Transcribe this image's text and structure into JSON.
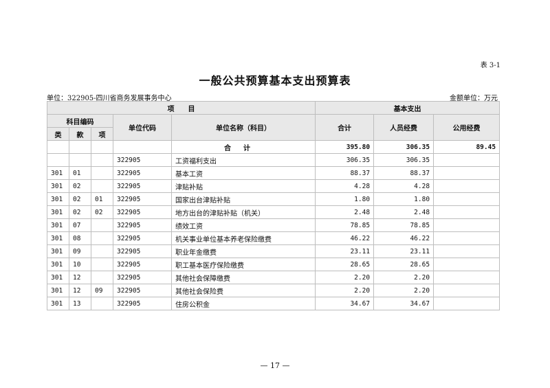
{
  "table_no": "表 3-1",
  "title": "一般公共预算基本支出预算表",
  "unit_left": "单位：322905-四川省商务发展事务中心",
  "unit_right": "金额单位：万元",
  "headers": {
    "item": "项　　目",
    "basic_expense": "基本支出",
    "subject_code": "科目编码",
    "lei": "类",
    "kuan": "款",
    "xiang": "项",
    "unit_code": "单位代码",
    "unit_name": "单位名称（科目）",
    "total": "合计",
    "personnel": "人员经费",
    "public": "公用经费"
  },
  "total_row": {
    "label": "合计",
    "total": "395.80",
    "personnel": "306.35",
    "public": "89.45"
  },
  "rows": [
    {
      "lei": "",
      "kuan": "",
      "xiang": "",
      "unit_code": "322905",
      "name": "工资福利支出",
      "total": "306.35",
      "personnel": "306.35",
      "public": "",
      "indent": false
    },
    {
      "lei": "301",
      "kuan": "01",
      "xiang": "",
      "unit_code": "322905",
      "name": "基本工资",
      "total": "88.37",
      "personnel": "88.37",
      "public": "",
      "indent": false
    },
    {
      "lei": "301",
      "kuan": "02",
      "xiang": "",
      "unit_code": "322905",
      "name": "津贴补贴",
      "total": "4.28",
      "personnel": "4.28",
      "public": "",
      "indent": false
    },
    {
      "lei": "301",
      "kuan": "02",
      "xiang": "01",
      "unit_code": "322905",
      "name": "国家出台津贴补贴",
      "total": "1.80",
      "personnel": "1.80",
      "public": "",
      "indent": true
    },
    {
      "lei": "301",
      "kuan": "02",
      "xiang": "02",
      "unit_code": "322905",
      "name": "地方出台的津贴补贴（机关）",
      "total": "2.48",
      "personnel": "2.48",
      "public": "",
      "indent": true
    },
    {
      "lei": "301",
      "kuan": "07",
      "xiang": "",
      "unit_code": "322905",
      "name": "绩效工资",
      "total": "78.85",
      "personnel": "78.85",
      "public": "",
      "indent": false
    },
    {
      "lei": "301",
      "kuan": "08",
      "xiang": "",
      "unit_code": "322905",
      "name": "机关事业单位基本养老保险缴费",
      "total": "46.22",
      "personnel": "46.22",
      "public": "",
      "indent": false
    },
    {
      "lei": "301",
      "kuan": "09",
      "xiang": "",
      "unit_code": "322905",
      "name": "职业年金缴费",
      "total": "23.11",
      "personnel": "23.11",
      "public": "",
      "indent": false
    },
    {
      "lei": "301",
      "kuan": "10",
      "xiang": "",
      "unit_code": "322905",
      "name": "职工基本医疗保险缴费",
      "total": "28.65",
      "personnel": "28.65",
      "public": "",
      "indent": false
    },
    {
      "lei": "301",
      "kuan": "12",
      "xiang": "",
      "unit_code": "322905",
      "name": "其他社会保障缴费",
      "total": "2.20",
      "personnel": "2.20",
      "public": "",
      "indent": false
    },
    {
      "lei": "301",
      "kuan": "12",
      "xiang": "09",
      "unit_code": "322905",
      "name": "其他社会保险费",
      "total": "2.20",
      "personnel": "2.20",
      "public": "",
      "indent": true
    },
    {
      "lei": "301",
      "kuan": "13",
      "xiang": "",
      "unit_code": "322905",
      "name": "住房公积金",
      "total": "34.67",
      "personnel": "34.67",
      "public": "",
      "indent": false
    }
  ],
  "page_no": "— 17 —"
}
